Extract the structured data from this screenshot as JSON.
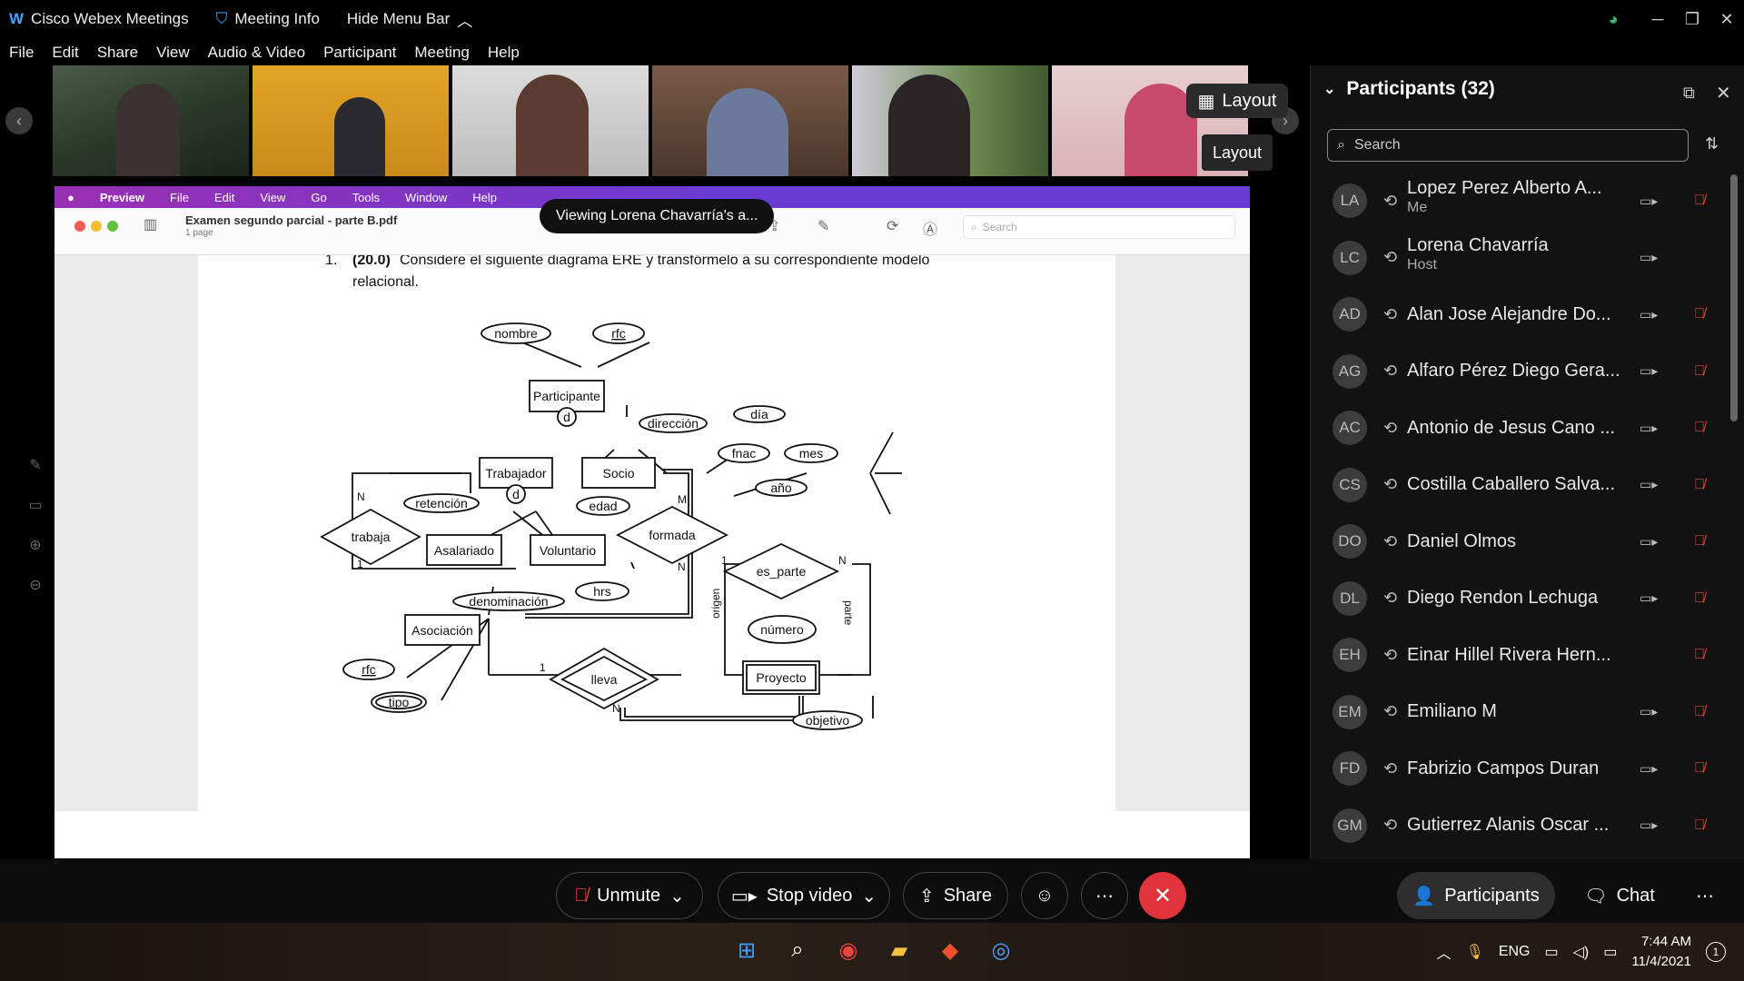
{
  "titlebar": {
    "app_title": "Cisco Webex Meetings",
    "meeting_info": "Meeting Info",
    "hide_menu": "Hide Menu Bar"
  },
  "menu": [
    "File",
    "Edit",
    "Share",
    "View",
    "Audio & Video",
    "Participant",
    "Meeting",
    "Help"
  ],
  "layout": {
    "button_label": "Layout",
    "tooltip": "Layout"
  },
  "shared_screen": {
    "mac_menu": [
      "Preview",
      "File",
      "Edit",
      "View",
      "Go",
      "Tools",
      "Window",
      "Help"
    ],
    "doc_title": "Examen segundo parcial - parte B.pdf",
    "doc_pages": "1 page",
    "search_placeholder": "Search",
    "viewing_banner": "Viewing Lorena Chavarría's a...",
    "question_number": "1.",
    "question_points": "(20.0)",
    "question_text_1": "Considere el siguiente diagrama ERE y transfórmelo a su correspondiente modelo",
    "question_text_2": "relacional."
  },
  "diagram": {
    "entities": [
      "Participante",
      "Trabajador",
      "Socio",
      "Asalariado",
      "Voluntario",
      "Asociación",
      "Proyecto"
    ],
    "attributes": [
      "nombre",
      "rfc",
      "dirección",
      "fnac",
      "día",
      "mes",
      "año",
      "retención",
      "edad",
      "hrs",
      "denominación",
      "rfc",
      "tipo",
      "número",
      "objetivo"
    ],
    "relationships": [
      "trabaja",
      "formada",
      "es_parte",
      "lleva"
    ],
    "specialization": "d",
    "cardinalities": [
      "N",
      "1",
      "M",
      "N",
      "1",
      "N",
      "1",
      "N"
    ],
    "role_labels": [
      "origen",
      "parte"
    ]
  },
  "participants_panel": {
    "title": "Participants (32)",
    "search_placeholder": "Search",
    "participants": [
      {
        "initials": "LA",
        "name": "Lopez Perez Alberto A...",
        "role": "Me"
      },
      {
        "initials": "LC",
        "name": "Lorena Chavarría",
        "role": "Host"
      },
      {
        "initials": "AD",
        "name": "Alan Jose Alejandre Do...",
        "role": ""
      },
      {
        "initials": "AG",
        "name": "Alfaro Pérez Diego Gera...",
        "role": ""
      },
      {
        "initials": "AC",
        "name": "Antonio de Jesus Cano ...",
        "role": ""
      },
      {
        "initials": "CS",
        "name": "Costilla Caballero Salva...",
        "role": ""
      },
      {
        "initials": "DO",
        "name": "Daniel Olmos",
        "role": ""
      },
      {
        "initials": "DL",
        "name": "Diego Rendon Lechuga",
        "role": ""
      },
      {
        "initials": "EH",
        "name": "Einar Hillel Rivera Hern...",
        "role": ""
      },
      {
        "initials": "EM",
        "name": "Emiliano M",
        "role": ""
      },
      {
        "initials": "FD",
        "name": "Fabrizio Campos Duran",
        "role": ""
      },
      {
        "initials": "GM",
        "name": "Gutierrez Alanis Oscar ...",
        "role": ""
      }
    ]
  },
  "controls": {
    "unmute": "Unmute",
    "stop_video": "Stop video",
    "share": "Share",
    "participants": "Participants",
    "chat": "Chat"
  },
  "taskbar": {
    "language": "ENG",
    "time": "7:44 AM",
    "date": "11/4/2021",
    "notifications": "1"
  },
  "colors": {
    "end_button": "#e0333a",
    "muted_mic": "#e0433a",
    "mac_menu": "#8b34c4"
  }
}
